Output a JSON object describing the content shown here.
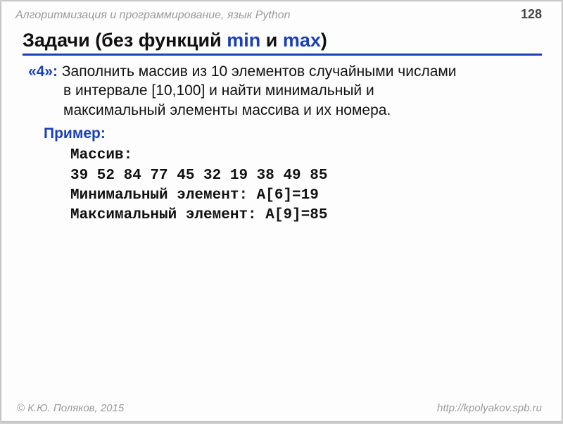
{
  "header": {
    "course": "Алгоритмизация и программирование, язык Python",
    "page": "128"
  },
  "title": {
    "prefix": "Задачи (без функций ",
    "kw1": "min",
    "mid": " и ",
    "kw2": "max",
    "suffix": ")"
  },
  "task": {
    "level": "«4»:",
    "text_line1": " Заполнить массив из 10 элементов случайными числами",
    "text_line2": "в интервале [10,100] и найти минимальный и",
    "text_line3": "максимальный элементы массива и их номера."
  },
  "example": {
    "label": "Пример:",
    "lines": [
      "Массив:",
      "39 52 84 77 45 32 19 38 49 85",
      "Минимальный элемент: A[6]=19",
      "Максимальный элемент: A[9]=85"
    ]
  },
  "footer": {
    "author": "© К.Ю. Поляков, 2015",
    "url": "http://kpolyakov.spb.ru"
  }
}
